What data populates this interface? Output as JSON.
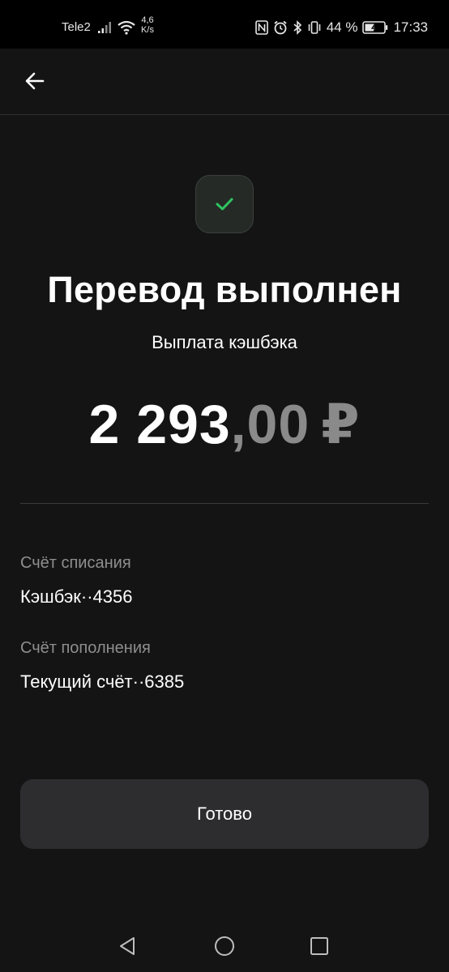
{
  "status_bar": {
    "carrier": "Tele2",
    "speed_value": "4,6",
    "speed_unit": "K/s",
    "battery": "44 %",
    "time": "17:33"
  },
  "transfer": {
    "title": "Перевод выполнен",
    "subtitle": "Выплата кэшбэка",
    "amount_integer": "2 293",
    "amount_decimal": ",00",
    "currency": "₽"
  },
  "details": {
    "from_label": "Счёт списания",
    "from_value": "Кэшбэк··4356",
    "to_label": "Счёт пополнения",
    "to_value": "Текущий счёт··6385"
  },
  "actions": {
    "done_label": "Готово"
  },
  "colors": {
    "background": "#141414",
    "success": "#2fc561",
    "muted": "#8a8a8a",
    "button": "#2d2d2f"
  }
}
